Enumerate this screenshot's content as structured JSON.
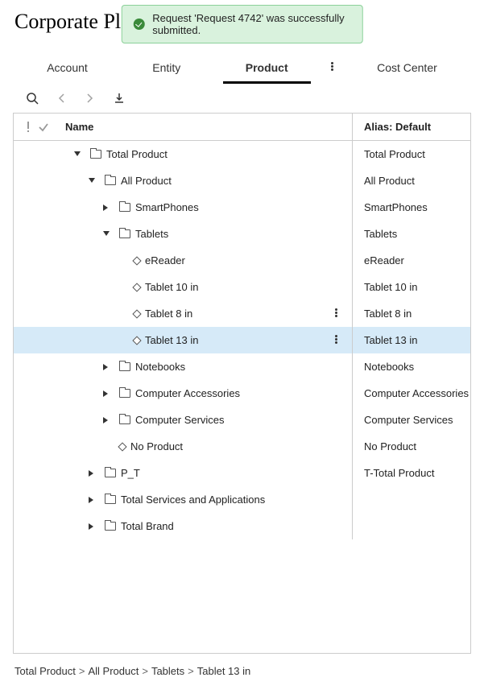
{
  "page_title": "Corporate Pl",
  "toast_message": "Request 'Request 4742' was successfully submitted.",
  "tabs": [
    {
      "label": "Account",
      "active": false
    },
    {
      "label": "Entity",
      "active": false
    },
    {
      "label": "Product",
      "active": true
    },
    {
      "label": "Cost Center",
      "active": false
    }
  ],
  "columns": {
    "name": "Name",
    "alias": "Alias: Default"
  },
  "rows": [
    {
      "indent": 0,
      "icon": "folder",
      "caret": "down",
      "name": "Total Product",
      "alias": "Total Product",
      "selected": false
    },
    {
      "indent": 1,
      "icon": "folder",
      "caret": "down",
      "name": "All Product",
      "alias": "All Product",
      "selected": false
    },
    {
      "indent": 2,
      "icon": "folder",
      "caret": "right",
      "name": "SmartPhones",
      "alias": "SmartPhones",
      "selected": false
    },
    {
      "indent": 2,
      "icon": "folder",
      "caret": "down",
      "name": "Tablets",
      "alias": "Tablets",
      "selected": false
    },
    {
      "indent": 3,
      "icon": "diamond",
      "caret": null,
      "name": "eReader",
      "alias": "eReader",
      "selected": false
    },
    {
      "indent": 3,
      "icon": "diamond",
      "caret": null,
      "name": "Tablet 10 in",
      "alias": "Tablet 10 in",
      "selected": false
    },
    {
      "indent": 3,
      "icon": "diamond",
      "caret": null,
      "name": "Tablet 8 in",
      "alias": "Tablet 8 in",
      "selected": false,
      "showMenu": true
    },
    {
      "indent": 3,
      "icon": "diamond",
      "caret": null,
      "name": "Tablet 13 in",
      "alias": "Tablet 13 in",
      "selected": true,
      "showMenu": true
    },
    {
      "indent": 2,
      "icon": "folder",
      "caret": "right",
      "name": "Notebooks",
      "alias": "Notebooks",
      "selected": false
    },
    {
      "indent": 2,
      "icon": "folder",
      "caret": "right",
      "name": "Computer Accessories",
      "alias": "Computer Accessories",
      "selected": false
    },
    {
      "indent": 2,
      "icon": "folder",
      "caret": "right",
      "name": "Computer Services",
      "alias": "Computer Services",
      "selected": false
    },
    {
      "indent": 2,
      "icon": "diamond",
      "caret": null,
      "name": "No Product",
      "alias": "No Product",
      "selected": false
    },
    {
      "indent": 1,
      "icon": "folder",
      "caret": "right",
      "name": "P_T",
      "alias": "T-Total Product",
      "selected": false
    },
    {
      "indent": 1,
      "icon": "folder",
      "caret": "right",
      "name": "Total Services and Applications",
      "alias": "",
      "selected": false
    },
    {
      "indent": 1,
      "icon": "folder",
      "caret": "right",
      "name": "Total Brand",
      "alias": "",
      "selected": false
    }
  ],
  "breadcrumb": [
    "Total Product",
    "All Product",
    "Tablets",
    "Tablet 13 in"
  ]
}
